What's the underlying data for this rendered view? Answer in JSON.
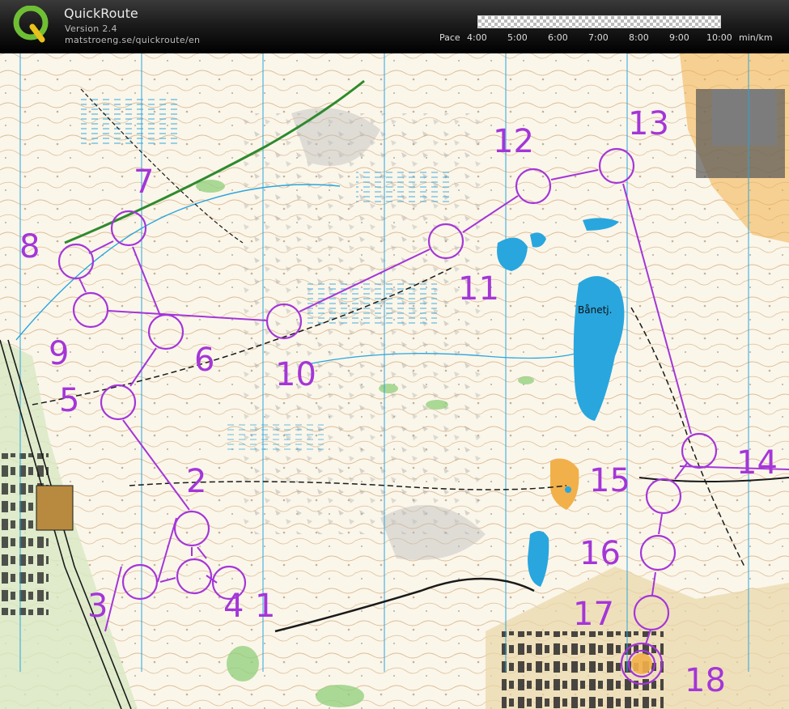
{
  "header": {
    "app_name": "QuickRoute",
    "version": "Version 2.4",
    "url": "matstroeng.se/quickroute/en",
    "logo_letter": "Q",
    "pace_label": "Pace",
    "pace_ticks": [
      "4:00",
      "5:00",
      "6:00",
      "7:00",
      "8:00",
      "9:00",
      "10:00"
    ],
    "pace_unit": "min/km"
  },
  "map": {
    "route_color": "#a436d8",
    "lake_label": "Bånetj.",
    "control_numbers": [
      "1",
      "2",
      "3",
      "4",
      "5",
      "6",
      "7",
      "8",
      "9",
      "10",
      "11",
      "12",
      "13",
      "14",
      "15",
      "16",
      "17",
      "18"
    ]
  },
  "colors": {
    "course": "#a436d8",
    "water": "#29a6de",
    "open_land": "#f3e3a0",
    "forest": "#fbf6ea",
    "green": "#8fcf7a",
    "contour": "#c28a4a",
    "road_black": "#1a1a1a",
    "urban": "#6a6a6a"
  }
}
